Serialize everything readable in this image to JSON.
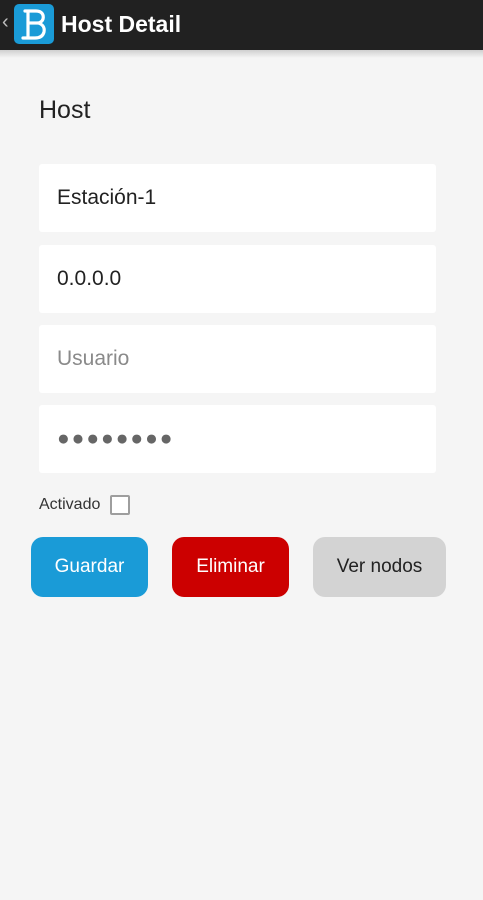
{
  "appbar": {
    "title": "Host Detail",
    "back_glyph": "‹",
    "logo_letter": "B",
    "logo_color": "#1a9bd7"
  },
  "section": {
    "title": "Host"
  },
  "form": {
    "name_value": "Estación-1",
    "ip_value": "0.0.0.0",
    "user_placeholder": "Usuario",
    "password_mask": "●●●●●●●●",
    "activated_label": "Activado",
    "activated_checked": false
  },
  "buttons": {
    "save_label": "Guardar",
    "delete_label": "Eliminar",
    "nodes_label": "Ver nodos"
  },
  "colors": {
    "primary": "#1a9bd7",
    "danger": "#cc0000",
    "neutral": "#d3d3d3"
  }
}
